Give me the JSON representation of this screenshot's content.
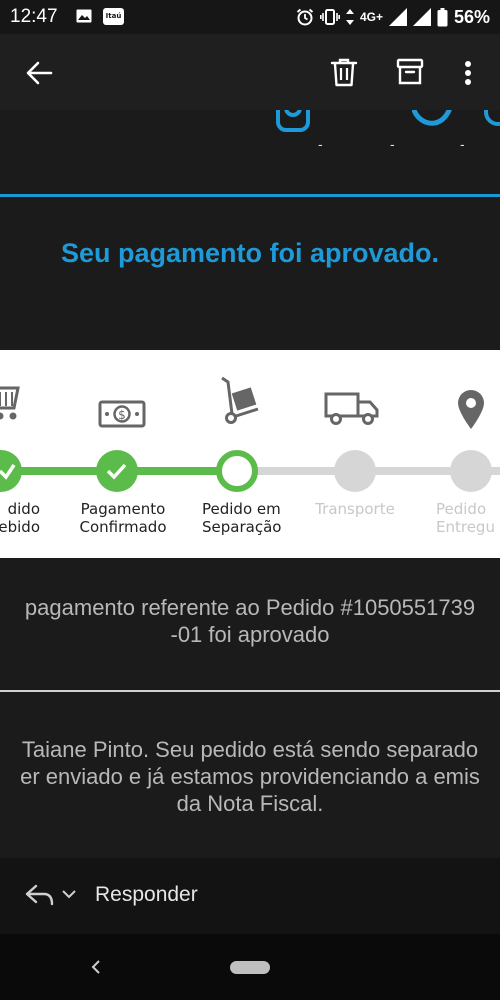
{
  "status_bar": {
    "time": "12:47",
    "notification_icons": [
      "gallery-icon",
      "itau-icon"
    ],
    "itau_label": "Itaú",
    "network": "4G+",
    "battery": "56%"
  },
  "app_bar": {
    "actions": [
      "back-icon",
      "trash-icon",
      "archive-icon",
      "more-vert-icon"
    ]
  },
  "email": {
    "social_dashes": [
      "-",
      "-",
      "-"
    ],
    "headline": "Seu pagamento foi aprovado.",
    "order_tracker": {
      "steps": [
        {
          "label_line1": "dido",
          "label_line2": "ebido",
          "state": "done"
        },
        {
          "label_line1": "Pagamento",
          "label_line2": "Confirmado",
          "state": "done"
        },
        {
          "label_line1": "Pedido em",
          "label_line2": "Separação",
          "state": "current"
        },
        {
          "label_line1": "Transporte",
          "label_line2": "",
          "state": "pending"
        },
        {
          "label_line1": "Pedido",
          "label_line2": "Entregu",
          "state": "pending"
        }
      ]
    },
    "payment_message_line1": "pagamento referente ao Pedido #1050551739",
    "payment_message_line2": "-01 foi aprovado",
    "body_line1": "Taiane Pinto. Seu pedido está sendo separado",
    "body_line2": "er enviado e já estamos providenciando a emis",
    "body_line3": "da Nota Fiscal."
  },
  "reply_bar": {
    "label": "Responder"
  },
  "colors": {
    "accent_blue": "#1e9ad8",
    "progress_green": "#5cbc4b",
    "pending_gray": "#d6d6d6",
    "background": "#1b1b1b"
  }
}
